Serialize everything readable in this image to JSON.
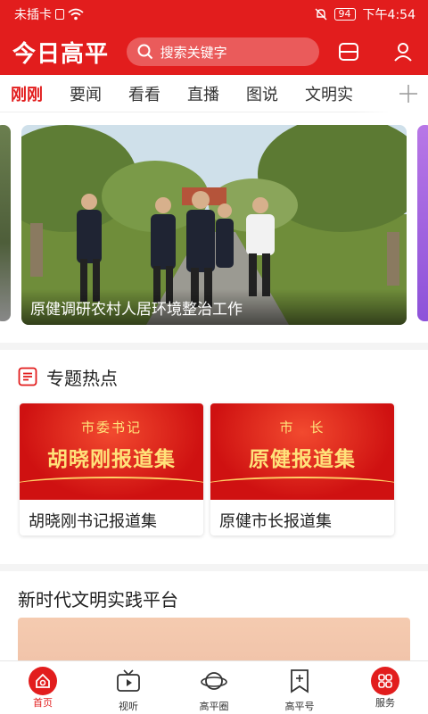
{
  "status_bar": {
    "carrier": "未插卡",
    "battery": "94",
    "time": "下午4:54"
  },
  "header": {
    "brand": "今日高平",
    "search_placeholder": "搜索关键字"
  },
  "tabs": [
    {
      "label": "刚刚",
      "active": true
    },
    {
      "label": "要闻"
    },
    {
      "label": "看看"
    },
    {
      "label": "直播"
    },
    {
      "label": "图说"
    },
    {
      "label": "文明实"
    }
  ],
  "carousel": {
    "caption": "原健调研农村人居环境整治工作"
  },
  "topics": {
    "title": "专题热点",
    "items": [
      {
        "banner_sup": "市委书记",
        "banner_title": "胡晓刚报道集",
        "title": "胡晓刚书记报道集"
      },
      {
        "banner_sup": "市　长",
        "banner_title": "原健报道集",
        "title": "原健市长报道集"
      }
    ]
  },
  "civilization": {
    "title": "新时代文明实践平台"
  },
  "bottom_nav": [
    {
      "label": "首页",
      "active": true
    },
    {
      "label": "视听"
    },
    {
      "label": "高平圈"
    },
    {
      "label": "高平号"
    },
    {
      "label": "服务"
    }
  ],
  "colors": {
    "brand_red": "#e21d1d"
  }
}
